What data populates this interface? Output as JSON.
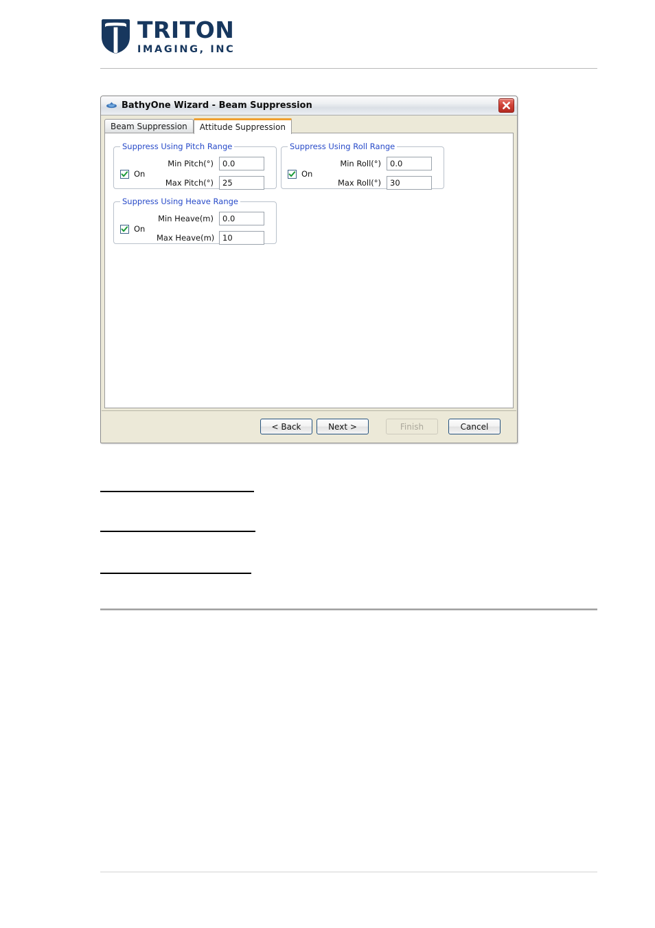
{
  "header": {
    "logo": {
      "icon": "triton-shield-logo",
      "brand": "TRITON",
      "tagline": "IMAGING, INC"
    }
  },
  "dialog": {
    "titlebar": {
      "icon": "bathyone-app-icon",
      "title": "BathyOne Wizard - Beam Suppression",
      "close_icon": "close-icon"
    },
    "tabs": [
      {
        "label": "Beam Suppression",
        "active": false
      },
      {
        "label": "Attitude Suppression",
        "active": true
      }
    ],
    "accent_color": "#f0a030",
    "group_label_color": "#2649c8",
    "groups": [
      {
        "id": "pitch",
        "label": "Suppress Using Pitch Range",
        "toggle": {
          "label": "On",
          "checked": true,
          "icon": "checkmark-icon"
        },
        "fields": [
          {
            "label": "Min Pitch(°)",
            "value": "0.0"
          },
          {
            "label": "Max Pitch(°)",
            "value": "25"
          }
        ]
      },
      {
        "id": "roll",
        "label": "Suppress Using Roll Range",
        "toggle": {
          "label": "On",
          "checked": true,
          "icon": "checkmark-icon"
        },
        "fields": [
          {
            "label": "Min Roll(°)",
            "value": "0.0"
          },
          {
            "label": "Max Roll(°)",
            "value": "30"
          }
        ]
      },
      {
        "id": "heave",
        "label": "Suppress Using Heave Range",
        "toggle": {
          "label": "On",
          "checked": true,
          "icon": "checkmark-icon"
        },
        "fields": [
          {
            "label": "Min Heave(m)",
            "value": "0.0"
          },
          {
            "label": "Max Heave(m)",
            "value": "10"
          }
        ]
      }
    ],
    "buttons": [
      {
        "id": "back",
        "label": "< Back",
        "disabled": false
      },
      {
        "id": "next",
        "label": "Next >",
        "disabled": false
      },
      {
        "id": "finish",
        "label": "Finish",
        "disabled": true
      },
      {
        "id": "cancel",
        "label": "Cancel",
        "disabled": false
      }
    ]
  }
}
